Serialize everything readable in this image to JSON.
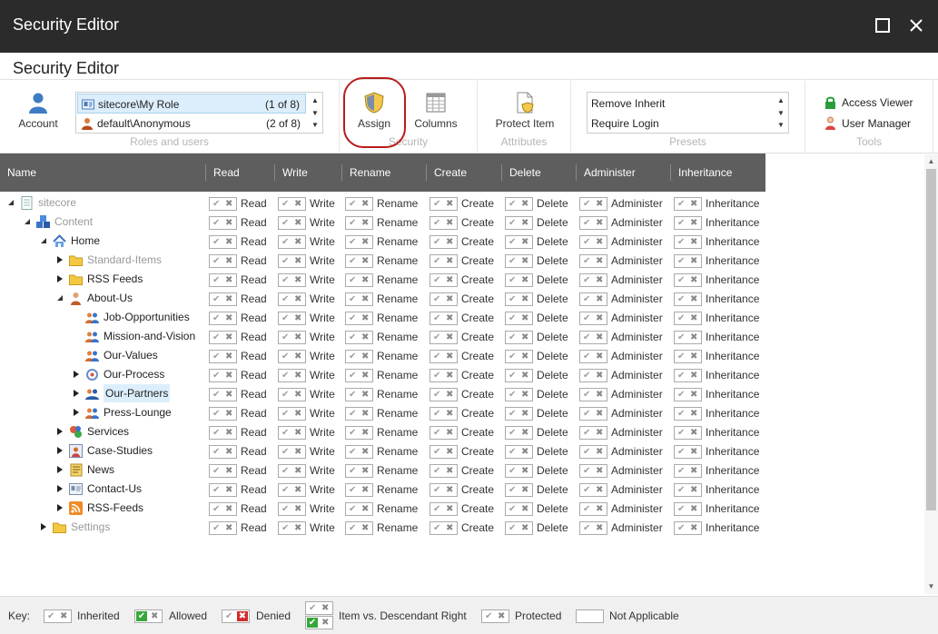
{
  "window": {
    "title": "Security Editor",
    "subtitle": "Security Editor"
  },
  "ribbon": {
    "account_label": "Account",
    "roles": [
      {
        "name": "sitecore\\My Role",
        "count": "(1 of 8)"
      },
      {
        "name": "default\\Anonymous",
        "count": "(2 of 8)"
      }
    ],
    "group_roles": "Roles and users",
    "assign_label": "Assign",
    "columns_label": "Columns",
    "group_security": "Security",
    "protect_label": "Protect Item",
    "group_attributes": "Attributes",
    "presets": [
      "Remove Inherit",
      "Require Login"
    ],
    "group_presets": "Presets",
    "access_viewer": "Access Viewer",
    "user_manager": "User Manager",
    "group_tools": "Tools"
  },
  "columns": [
    "Name",
    "Read",
    "Write",
    "Rename",
    "Create",
    "Delete",
    "Administer",
    "Inheritance"
  ],
  "rights": [
    "Read",
    "Write",
    "Rename",
    "Create",
    "Delete",
    "Administer",
    "Inheritance"
  ],
  "tree": [
    {
      "label": "sitecore",
      "icon": "page-icon"
    },
    {
      "label": "Content",
      "icon": "content-icon"
    },
    {
      "label": "Home",
      "icon": "home-icon"
    },
    {
      "label": "Standard-Items",
      "icon": "folder-icon"
    },
    {
      "label": "RSS Feeds",
      "icon": "folder-icon"
    },
    {
      "label": "About-Us",
      "icon": "person-icon"
    },
    {
      "label": "Job-Opportunities",
      "icon": "people-icon"
    },
    {
      "label": "Mission-and-Vision",
      "icon": "people-icon"
    },
    {
      "label": "Our-Values",
      "icon": "people-icon"
    },
    {
      "label": "Our-Process",
      "icon": "process-icon"
    },
    {
      "label": "Our-Partners",
      "icon": "partners-icon"
    },
    {
      "label": "Press-Lounge",
      "icon": "people-icon"
    },
    {
      "label": "Services",
      "icon": "services-icon"
    },
    {
      "label": "Case-Studies",
      "icon": "casestudy-icon"
    },
    {
      "label": "News",
      "icon": "news-icon"
    },
    {
      "label": "Contact-Us",
      "icon": "contact-icon"
    },
    {
      "label": "RSS-Feeds",
      "icon": "rss-icon"
    },
    {
      "label": "Settings",
      "icon": "folder-icon"
    }
  ],
  "key": {
    "label": "Key:",
    "inherited": "Inherited",
    "allowed": "Allowed",
    "denied": "Denied",
    "item_vs_descendant": "Item vs. Descendant Right",
    "protected": "Protected",
    "not_applicable": "Not Applicable"
  },
  "glyphs": {
    "check": "✔",
    "cross": "✖",
    "close": "✕",
    "maximize": "☐"
  }
}
